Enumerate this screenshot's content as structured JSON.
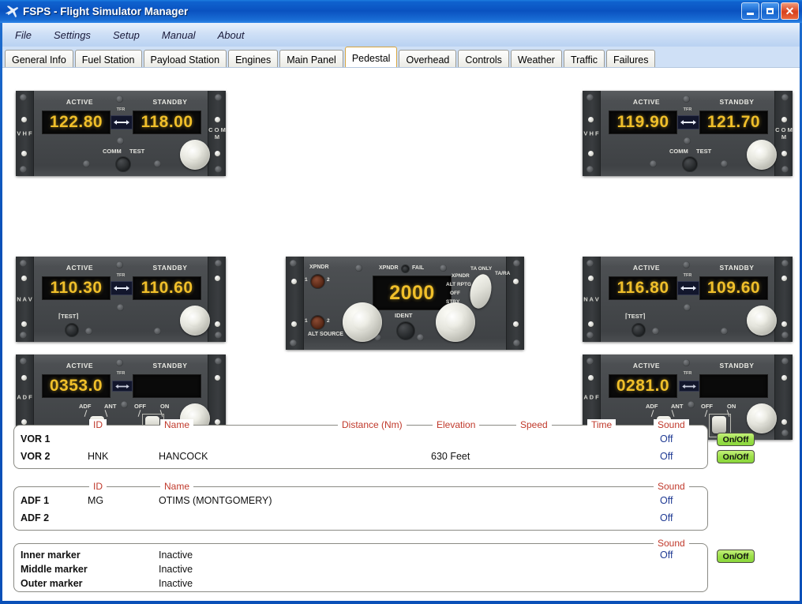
{
  "window": {
    "title": "FSPS - Flight Simulator Manager",
    "icon": "airplane-icon",
    "buttons": {
      "minimize": "minimize-icon",
      "maximize": "maximize-icon",
      "close": "close-icon"
    }
  },
  "menu": {
    "items": [
      "File",
      "Settings",
      "Setup",
      "Manual",
      "About"
    ]
  },
  "tabs": {
    "active": "Pedestal",
    "items": [
      "General Info",
      "Fuel Station",
      "Payload Station",
      "Engines",
      "Main Panel",
      "Pedestal",
      "Overhead",
      "Controls",
      "Weather",
      "Traffic",
      "Failures"
    ]
  },
  "radios": {
    "labels": {
      "active": "ACTIVE",
      "standby": "STANDBY",
      "tfr": "TFR",
      "comm": "COMM",
      "test": "TEST",
      "test_bracket": "TEST",
      "adf": "ADF",
      "ant": "ANT",
      "off": "OFF",
      "on": "ON"
    },
    "panels": [
      {
        "id": "comm1",
        "kind": "comm",
        "side_left": "V H F",
        "side_right": "C O M M",
        "active": "122.80",
        "standby": "118.00"
      },
      {
        "id": "nav1",
        "kind": "nav",
        "side_left": "N A V",
        "side_right": "",
        "active": "110.30",
        "standby": "110.60"
      },
      {
        "id": "adf1",
        "kind": "adf",
        "side_left": "A D F",
        "side_right": "",
        "active": "0353.0",
        "standby": ""
      },
      {
        "id": "comm2",
        "kind": "comm",
        "side_left": "V H F",
        "side_right": "C O M M",
        "active": "119.90",
        "standby": "121.70"
      },
      {
        "id": "nav2",
        "kind": "nav",
        "side_left": "N A V",
        "side_right": "",
        "active": "116.80",
        "standby": "109.60"
      },
      {
        "id": "adf2",
        "kind": "adf",
        "side_left": "A D F",
        "side_right": "",
        "active": "0281.0",
        "standby": ""
      }
    ]
  },
  "transponder": {
    "code": "2000",
    "labels": {
      "xpdr_sel": "XPNDR",
      "xpdr_fail": "XPNDR",
      "fail": "FAIL",
      "alt_source": "ALT SOURCE",
      "ident": "IDENT",
      "one": "1",
      "two": "2",
      "mode_xpndr": "XPNDR",
      "mode_alt_rptg": "ALT RPTG",
      "mode_off": "OFF",
      "mode_stby": "STBY",
      "mode_ta_only": "TA ONLY",
      "mode_ta_ra": "TA/RA"
    }
  },
  "vor_group": {
    "headers": {
      "id": "ID",
      "name": "Name",
      "distance": "Distance (Nm)",
      "elevation": "Elevation",
      "speed": "Speed",
      "time": "Time",
      "sound": "Sound"
    },
    "rows": [
      {
        "label": "VOR 1",
        "id": "",
        "name": "",
        "distance": "",
        "elevation": "",
        "speed": "",
        "time": "",
        "sound": "Off",
        "button": "On/Off"
      },
      {
        "label": "VOR 2",
        "id": "HNK",
        "name": "HANCOCK",
        "distance": "",
        "elevation": "630 Feet",
        "speed": "",
        "time": "",
        "sound": "Off",
        "button": "On/Off"
      }
    ]
  },
  "adf_group": {
    "headers": {
      "id": "ID",
      "name": "Name",
      "sound": "Sound"
    },
    "rows": [
      {
        "label": "ADF 1",
        "id": "MG",
        "name": "OTIMS (MONTGOMERY)",
        "sound": "Off"
      },
      {
        "label": "ADF 2",
        "id": "",
        "name": "",
        "sound": "Off"
      }
    ]
  },
  "marker_group": {
    "headers": {
      "sound": "Sound"
    },
    "rows": [
      {
        "label": "Inner marker",
        "status": "Inactive",
        "sound": "Off"
      },
      {
        "label": "Middle marker",
        "status": "Inactive",
        "sound": ""
      },
      {
        "label": "Outer marker",
        "status": "Inactive",
        "sound": ""
      }
    ],
    "button": "On/Off"
  },
  "colors": {
    "title_blue": "#0a52c0",
    "header_red": "#c0392b",
    "sound_blue": "#1f3a93",
    "button_green": "#9ce04a",
    "lcd_amber": "#f0bf2a",
    "active_tab_border": "#d7a43c"
  }
}
